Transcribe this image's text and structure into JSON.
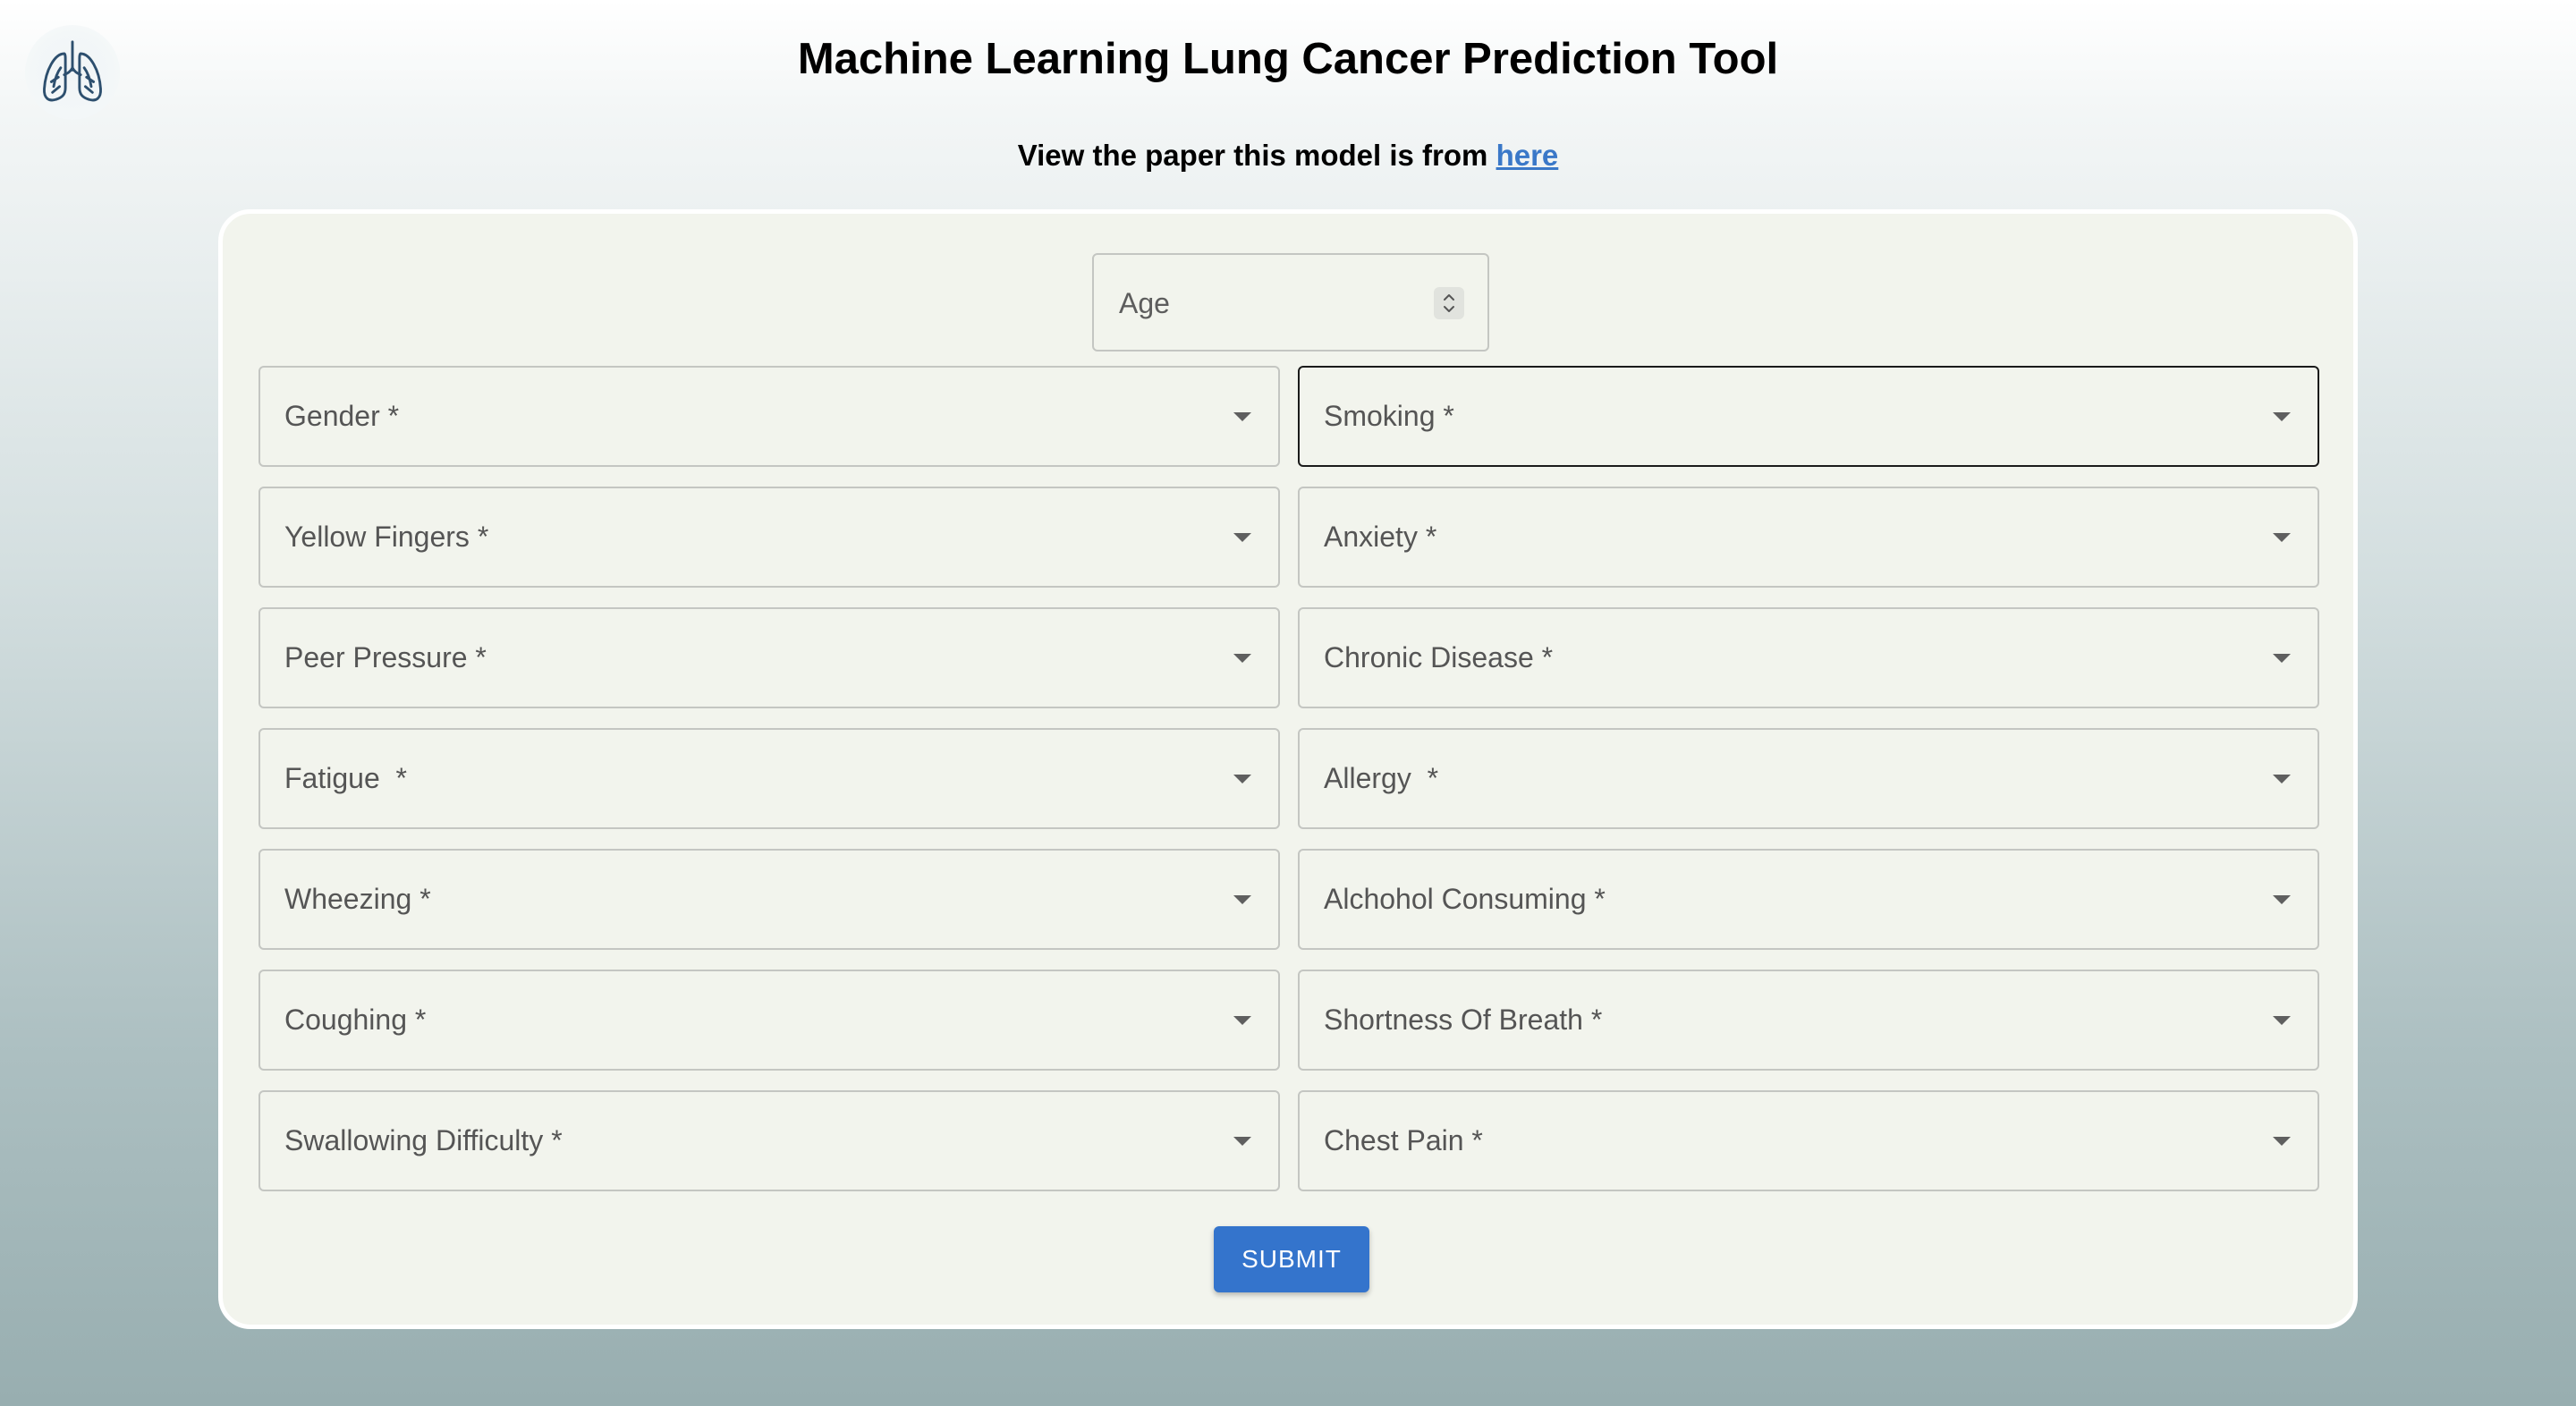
{
  "header": {
    "title": "Machine Learning Lung Cancer Prediction Tool",
    "subtitle_prefix": "View the paper this model is from",
    "link_text": "here",
    "logo_icon": "lungs-icon"
  },
  "form": {
    "age": {
      "placeholder": "Age"
    },
    "fields": [
      {
        "label": "Gender *"
      },
      {
        "label": "Smoking *"
      },
      {
        "label": "Yellow Fingers *"
      },
      {
        "label": "Anxiety *"
      },
      {
        "label": "Peer Pressure *"
      },
      {
        "label": "Chronic Disease *"
      },
      {
        "label": "Fatigue  *"
      },
      {
        "label": "Allergy  *"
      },
      {
        "label": "Wheezing *"
      },
      {
        "label": "Alchohol Consuming *"
      },
      {
        "label": "Coughing *"
      },
      {
        "label": "Shortness Of Breath *"
      },
      {
        "label": "Swallowing Difficulty *"
      },
      {
        "label": "Chest Pain *"
      }
    ],
    "submit_label": "SUBMIT"
  },
  "colors": {
    "accent": "#3474cc",
    "link": "#3a78c8",
    "card_background": "#f2f4ed",
    "field_border": "#c4c6c2",
    "focused_border": "#1b1b1b"
  }
}
